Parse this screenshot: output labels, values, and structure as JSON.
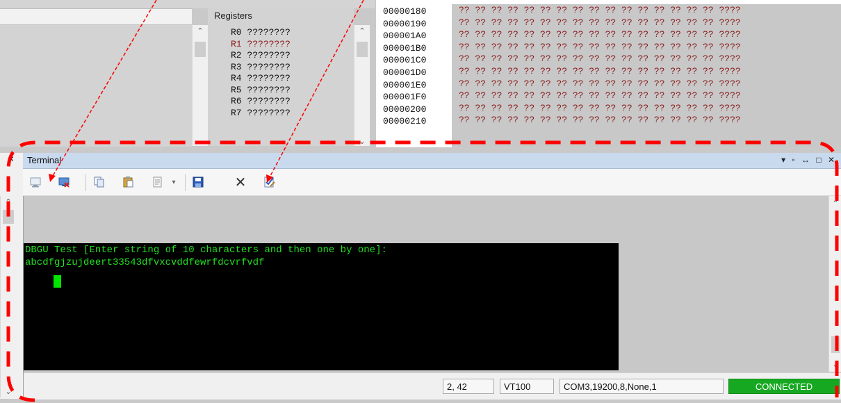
{
  "registers": {
    "title": "Registers",
    "items": [
      {
        "name": "R0",
        "value": "????????"
      },
      {
        "name": "R1",
        "value": "????????"
      },
      {
        "name": "R2",
        "value": "????????"
      },
      {
        "name": "R3",
        "value": "????????"
      },
      {
        "name": "R4",
        "value": "????????"
      },
      {
        "name": "R5",
        "value": "????????"
      },
      {
        "name": "R6",
        "value": "????????"
      },
      {
        "name": "R7",
        "value": "????????"
      }
    ]
  },
  "memory": {
    "addresses": [
      "00000180",
      "00000190",
      "000001A0",
      "000001B0",
      "000001C0",
      "000001D0",
      "000001E0",
      "000001F0",
      "00000200",
      "00000210"
    ],
    "row_text": "?? ?? ?? ?? ?? ?? ?? ?? ?? ?? ?? ?? ?? ?? ?? ?? ????"
  },
  "terminal": {
    "title": "Terminal",
    "window_controls": "▾ ▫ ↔ □ ✕",
    "line1": "DBGU Test [Enter string of 10 characters and then one by one]:",
    "line2": "abcdfgjzujdeert33543dfvxcvddfewrfdcvrfvdf",
    "close_glyph": "✕",
    "dropdown_glyph": "▾"
  },
  "statusbar": {
    "position": "2, 42",
    "emulation": "VT100",
    "port": "COM3,19200,8,None,1",
    "state": "CONNECTED"
  },
  "left_panel": {
    "close_glyph": "×"
  },
  "colors": {
    "connected": "#17a822",
    "terminal_text": "#21e021",
    "annotation": "#ff0000",
    "register_highlight": "#8b1a1a"
  },
  "icons": [
    "connect-icon",
    "disconnect-icon",
    "copy-icon",
    "paste-icon",
    "paste-special-icon",
    "save-icon",
    "clear-icon",
    "settings-check-icon"
  ]
}
